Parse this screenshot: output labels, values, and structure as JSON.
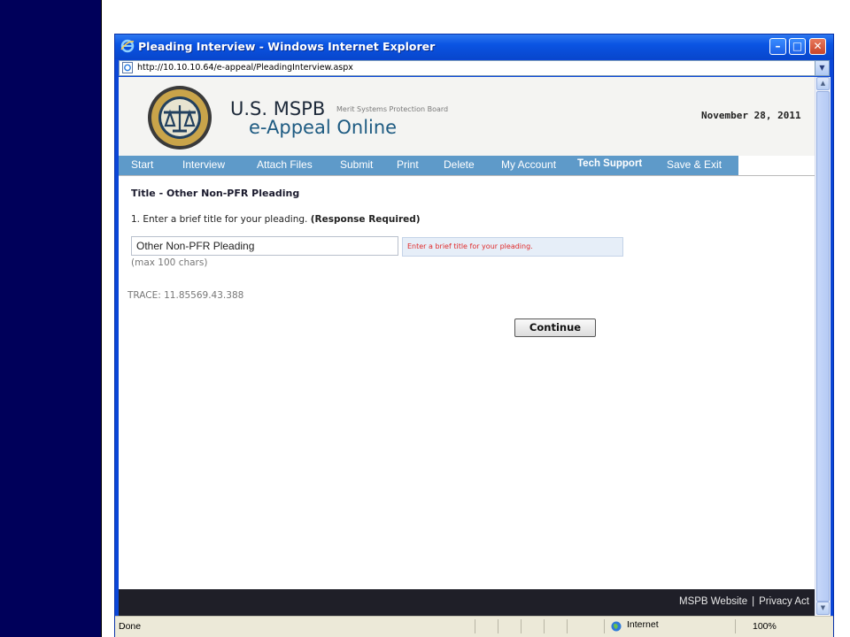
{
  "window": {
    "title": "Pleading Interview - Windows Internet Explorer",
    "url": "http://10.10.10.64/e-appeal/PleadingInterview.aspx"
  },
  "header": {
    "brand_line1": "U.S. MSPB",
    "brand_sub": "Merit Systems Protection Board",
    "brand_line2": "e-Appeal Online",
    "date": "November 28, 2011"
  },
  "nav": {
    "items": [
      {
        "label": "Start"
      },
      {
        "label": "Interview"
      },
      {
        "label": "Attach Files"
      },
      {
        "label": "Submit"
      },
      {
        "label": "Print"
      },
      {
        "label": "Delete"
      },
      {
        "label": "My Account"
      },
      {
        "label": "Tech Support"
      },
      {
        "label": "Save & Exit"
      }
    ]
  },
  "form": {
    "section_title": "Title - Other Non-PFR Pleading",
    "question": "1. Enter a brief title for your pleading.",
    "required_note": "(Response Required)",
    "title_value": "Other Non-PFR Pleading",
    "hint": "Enter a brief title for your pleading.",
    "max_chars": "(max 100 chars)",
    "trace": "TRACE: 11.85569.43.388",
    "continue_label": "Continue"
  },
  "footer": {
    "website_link": "MSPB Website",
    "separator": "|",
    "privacy_link": "Privacy Act"
  },
  "statusbar": {
    "status": "Done",
    "zone": "Internet",
    "zoom": "100%"
  },
  "colors": {
    "slide_bar": "#00005a",
    "nav_bar": "#5e9ac9",
    "footer": "#1f1f28",
    "hint_text": "#e02a2a"
  }
}
